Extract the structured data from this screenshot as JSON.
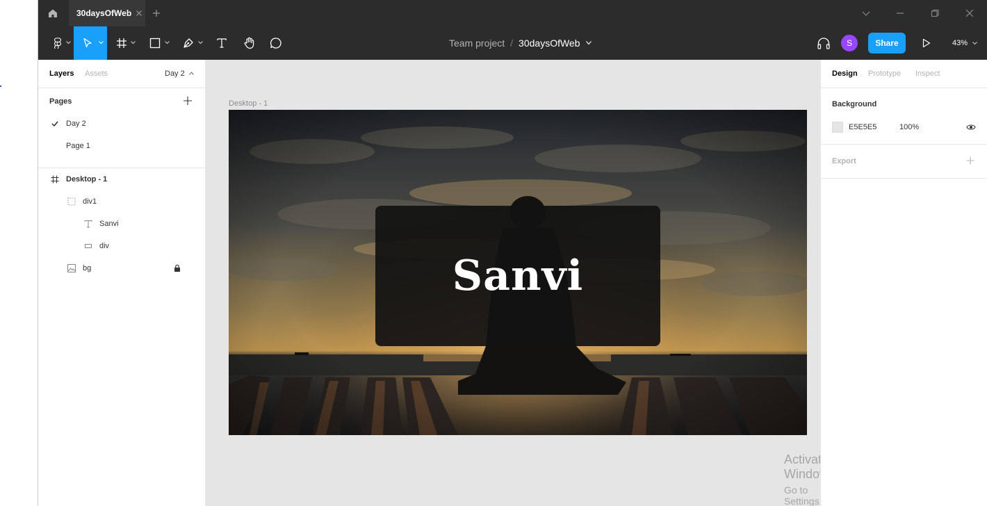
{
  "titlebar": {
    "tab_label": "30daysOfWeb"
  },
  "toolbar": {
    "breadcrumb_team": "Team project",
    "breadcrumb_sep": "/",
    "breadcrumb_file": "30daysOfWeb",
    "avatar_initial": "S",
    "share_label": "Share",
    "zoom_label": "43%"
  },
  "left_panel": {
    "tabs": {
      "layers": "Layers",
      "assets": "Assets",
      "page_selector": "Day 2"
    },
    "pages_heading": "Pages",
    "pages": [
      {
        "label": "Day 2",
        "selected": true
      },
      {
        "label": "Page 1",
        "selected": false
      }
    ],
    "layers": [
      {
        "label": "Desktop - 1",
        "icon": "frame-icon"
      },
      {
        "label": "div1",
        "icon": "group-icon"
      },
      {
        "label": "Sanvi",
        "icon": "text-icon"
      },
      {
        "label": "div",
        "icon": "rectangle-icon"
      },
      {
        "label": "bg",
        "icon": "image-icon",
        "locked": true
      }
    ]
  },
  "canvas": {
    "frame_label": "Desktop - 1",
    "card_text": "Sanvi",
    "activate_title": "Activate Windows",
    "activate_sub": "Go to Settings to activate Windows.",
    "help_label": "?"
  },
  "right_panel": {
    "tabs": {
      "design": "Design",
      "prototype": "Prototype",
      "inspect": "Inspect"
    },
    "background_title": "Background",
    "bg_hex": "E5E5E5",
    "bg_opacity": "100%",
    "export_title": "Export"
  },
  "colors": {
    "accent": "#18a0fb",
    "avatar": "#9747ff",
    "canvas_bg": "#e5e5e5"
  }
}
